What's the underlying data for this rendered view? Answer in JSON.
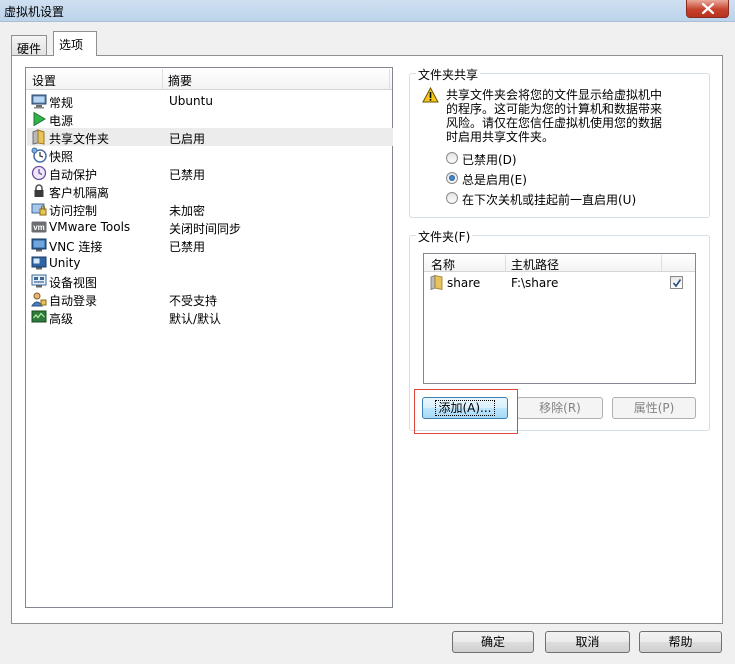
{
  "window": {
    "title": "虚拟机设置",
    "close_icon": "close-icon"
  },
  "tabs": [
    {
      "label": "硬件",
      "active": false
    },
    {
      "label": "选项",
      "active": true
    }
  ],
  "settings": {
    "columns": [
      "设置",
      "摘要"
    ],
    "selected_index": 2,
    "items": [
      {
        "icon": "monitor-icon",
        "name": "常规",
        "summary": "Ubuntu"
      },
      {
        "icon": "power-play-icon",
        "name": "电源",
        "summary": ""
      },
      {
        "icon": "shared-folder-icon",
        "name": "共享文件夹",
        "summary": "已启用"
      },
      {
        "icon": "snapshot-clock-icon",
        "name": "快照",
        "summary": ""
      },
      {
        "icon": "autoprotect-icon",
        "name": "自动保护",
        "summary": "已禁用"
      },
      {
        "icon": "lock-icon",
        "name": "客户机隔离",
        "summary": ""
      },
      {
        "icon": "access-control-icon",
        "name": "访问控制",
        "summary": "未加密"
      },
      {
        "icon": "vmware-tools-icon",
        "name": "VMware Tools",
        "summary": "关闭时间同步"
      },
      {
        "icon": "vnc-icon",
        "name": "VNC 连接",
        "summary": "已禁用"
      },
      {
        "icon": "unity-icon",
        "name": "Unity",
        "summary": ""
      },
      {
        "icon": "device-view-icon",
        "name": "设备视图",
        "summary": ""
      },
      {
        "icon": "autologin-icon",
        "name": "自动登录",
        "summary": "不受支持"
      },
      {
        "icon": "advanced-icon",
        "name": "高级",
        "summary": "默认/默认"
      }
    ]
  },
  "folder_sharing": {
    "title": "文件夹共享",
    "warning_icon": "warning-icon",
    "warning_lines": [
      "共享文件夹会将您的文件显示给虚拟机中",
      "的程序。这可能为您的计算机和数据带来",
      "风险。请仅在您信任虚拟机使用您的数据",
      "时启用共享文件夹。"
    ],
    "options": [
      {
        "label": "已禁用(D)",
        "checked": false
      },
      {
        "label": "总是启用(E)",
        "checked": true
      },
      {
        "label": "在下次关机或挂起前一直启用(U)",
        "checked": false
      }
    ]
  },
  "folders": {
    "title": "文件夹(F)",
    "columns": [
      "名称",
      "主机路径"
    ],
    "rows": [
      {
        "icon": "folder-icon",
        "name": "share",
        "path": "F:\\share",
        "enabled": true
      }
    ],
    "buttons": {
      "add": "添加(A)...",
      "remove": "移除(R)",
      "properties": "属性(P)"
    }
  },
  "footer": {
    "ok": "确定",
    "cancel": "取消",
    "help": "帮助"
  },
  "colors": {
    "highlight_outline": "#e0473c",
    "close_button": "#c7432e",
    "radio_checked": "#1e4d8a"
  }
}
